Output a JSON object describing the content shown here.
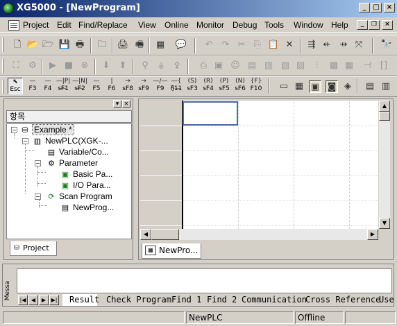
{
  "window": {
    "title": "XG5000 - [NewProgram]"
  },
  "menu": {
    "items": [
      "Project",
      "Edit",
      "Find/Replace",
      "View",
      "Online",
      "Monitor",
      "Debug",
      "Tools",
      "Window",
      "Help"
    ]
  },
  "function_keys": [
    {
      "sym": "",
      "label": "Esc"
    },
    {
      "sym": "—",
      "label": "F3"
    },
    {
      "sym": "—",
      "label": "F4"
    },
    {
      "sym": "—|P|—",
      "label": "sF1"
    },
    {
      "sym": "—|N|—",
      "label": "sF2"
    },
    {
      "sym": "—",
      "label": "F5"
    },
    {
      "sym": "|",
      "label": "F6"
    },
    {
      "sym": "→",
      "label": "sF8"
    },
    {
      "sym": "→",
      "label": "sF9"
    },
    {
      "sym": "—/—",
      "label": "F9"
    },
    {
      "sym": "—{ }—",
      "label": "F11"
    },
    {
      "sym": "(S)",
      "label": "sF3"
    },
    {
      "sym": "(R)",
      "label": "sF4"
    },
    {
      "sym": "(P)",
      "label": "sF5"
    },
    {
      "sym": "(N)",
      "label": "sF6"
    },
    {
      "sym": "{F}",
      "label": "F10"
    }
  ],
  "project_panel": {
    "header": "항목",
    "tab_label": "Project",
    "tree": [
      {
        "label": "Example *"
      },
      {
        "label": "NewPLC(XGK-..."
      },
      {
        "label": "Variable/Co..."
      },
      {
        "label": "Parameter"
      },
      {
        "label": "Basic Pa..."
      },
      {
        "label": "I/O Para..."
      },
      {
        "label": "Scan Program"
      },
      {
        "label": "NewProg..."
      }
    ]
  },
  "editor": {
    "tab_label": "NewPro..."
  },
  "message_window": {
    "side_label": "Messa",
    "tabs": [
      "Result",
      "Check Program",
      "Find 1",
      "Find 2",
      "Communication",
      "Cross Reference",
      "Use"
    ]
  },
  "statusbar": {
    "plc": "NewPLC",
    "mode": "Offline"
  },
  "colors": {
    "title_start": "#0a246a",
    "title_end": "#a6caf0",
    "cursor": "#4a6aa8"
  }
}
